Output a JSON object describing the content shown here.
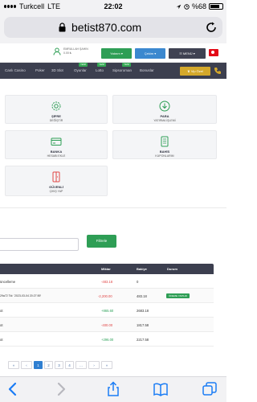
{
  "status_bar": {
    "carrier": "Turkcell",
    "network": "LTE",
    "time": "22:02",
    "battery": "%68"
  },
  "browser": {
    "url": "betist870.com"
  },
  "header": {
    "user_line1": "EMRULLAH ŞAHIN",
    "user_line2": "0.00 ₺",
    "deposit_label": "Yatırım",
    "withdraw_label": "Çekim",
    "menu_label": "MENÜ"
  },
  "nav": {
    "items": [
      {
        "label": "Canlı Casino",
        "badge": ""
      },
      {
        "label": "Poker",
        "badge": ""
      },
      {
        "label": "3D Slot",
        "badge": ""
      },
      {
        "label": "Oyunlar",
        "badge": "YENİ"
      },
      {
        "label": "Lotto",
        "badge": "YENİ"
      },
      {
        "label": "Sipsoroman",
        "badge": "YENİ"
      },
      {
        "label": "Bonuslar",
        "badge": ""
      }
    ],
    "vip_label": "Vip Özel"
  },
  "cards": [
    {
      "title": "ŞİFRE",
      "sub": "DEĞİŞTİR",
      "icon": "gear-icon"
    },
    {
      "title": "PARA",
      "sub": "YATIRMA İŞLEMİ",
      "icon": "download-icon"
    },
    {
      "title": "BANKA",
      "sub": "HESABI EKLE",
      "icon": "bank-card-icon"
    },
    {
      "title": "BAHİS",
      "sub": "KUPONLARIM",
      "icon": "coupon-icon"
    },
    {
      "title": "GÜVENLİ",
      "sub": "ÇIKIŞ YAP",
      "icon": "exit-door-icon"
    }
  ],
  "filter": {
    "button_label": "Filtrele"
  },
  "table": {
    "headers": [
      "Miktar",
      "Bakiye",
      "Durum"
    ],
    "rows": [
      {
        "desc": "üncelleme",
        "amount": "-483.18",
        "balance": "0",
        "status": "",
        "sign": "neg"
      },
      {
        "desc": "29a72 Tid: '2023-03-04 20:27:59'",
        "amount": "-2,200.00",
        "balance": "483.18",
        "status": "ÖDEME YAPILDI",
        "sign": "neg"
      },
      {
        "desc": "ot",
        "amount": "+865.60",
        "balance": "2683.18",
        "status": "",
        "sign": "pos"
      },
      {
        "desc": "ot",
        "amount": "-400.00",
        "balance": "1817.58",
        "status": "",
        "sign": "neg"
      },
      {
        "desc": "ot",
        "amount": "+296.00",
        "balance": "2217.58",
        "status": "",
        "sign": "pos"
      }
    ]
  },
  "pagination": {
    "first": "«",
    "prev": "‹",
    "pages": [
      "1",
      "2",
      "3",
      "4"
    ],
    "ellipsis": "…",
    "next": "›",
    "last": "»",
    "current": "1"
  },
  "colors": {
    "nav_bg": "#3c3f4f",
    "green": "#2e9e55",
    "blue": "#3b88cf",
    "gold": "#d4a82b",
    "negative": "#e04646",
    "positive": "#2ea25a"
  }
}
